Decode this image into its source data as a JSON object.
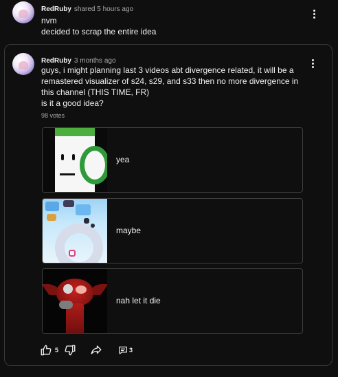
{
  "shared_post": {
    "author": "RedRuby",
    "meta": "shared 5 hours ago",
    "lines": [
      "nvm",
      "decided to scrap the entire idea"
    ]
  },
  "post": {
    "author": "RedRuby",
    "meta": "3 months ago",
    "body_lines": [
      "guys, i might planning last 3 videos abt divergence related, it will be a",
      "remastered visualizer of s24, s29, and s33 then no more divergence in",
      "this channel (THIS TIME, FR)",
      "is it a good idea?"
    ],
    "votes": "98 votes",
    "poll_options": [
      {
        "label": "yea"
      },
      {
        "label": "maybe"
      },
      {
        "label": "nah let it die"
      }
    ],
    "toolbar": {
      "like_count": "5",
      "comment_count": "3"
    }
  },
  "icons": {
    "like": "thumbs-up-icon",
    "dislike": "thumbs-down-icon",
    "share": "share-arrow-icon",
    "comment": "comment-icon",
    "menu": "kebab-menu-icon"
  }
}
